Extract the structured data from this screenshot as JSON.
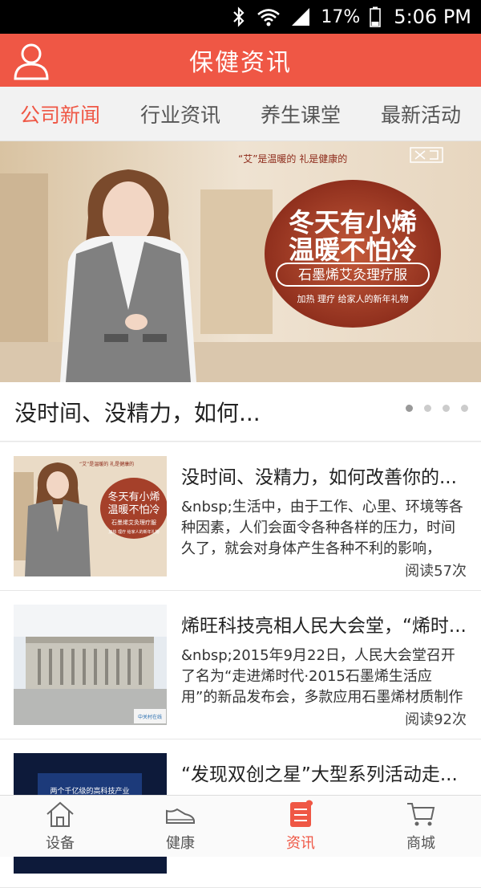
{
  "status_bar": {
    "battery": "17%",
    "time": "5:06 PM",
    "icons": [
      "bluetooth-icon",
      "wifi-icon",
      "signal-icon",
      "battery-icon"
    ]
  },
  "app_bar": {
    "title": "保健资讯",
    "left_icon": "user-icon"
  },
  "tabs": [
    {
      "label": "公司新闻",
      "active": true
    },
    {
      "label": "行业资讯",
      "active": false
    },
    {
      "label": "养生课堂",
      "active": false
    },
    {
      "label": "最新活动",
      "active": false
    }
  ],
  "banner": {
    "tagline": "“艾”是温暖的 礼是健康的",
    "headline_1": "冬天有小烯",
    "headline_2": "温暖不怕冷",
    "product": "石墨烯艾灸理疗服",
    "subline": "加热 理疗 给家人的新年礼物",
    "caption": "没时间、没精力，如何...",
    "page_count": 4,
    "active_page": 0
  },
  "articles": [
    {
      "title": "没时间、没精力，如何改善你的...",
      "desc": "&nbsp;生活中，由于工作、心里、环境等各种因素，人们会面令各种各样的压力，时间久了，就会对身体产生各种不利的影响，",
      "reads": "阅读57次",
      "thumb": "vest-ad-image",
      "thumb_text": {
        "tagline": "“艾”是温暖的 礼是健康的",
        "line1": "冬天有小烯",
        "line2": "温暖不怕冷",
        "product": "石墨烯艾灸理疗服",
        "subline": "加热 理疗 给家人的新年礼物"
      }
    },
    {
      "title": "烯旺科技亮相人民大会堂，“烯时...",
      "desc": "&nbsp;2015年9月22日，人民大会堂召开了名为“走进烯时代·2015石墨烯生活应用”的新品发布会，多款应用石墨烯材质制作的民...",
      "reads": "阅读92次",
      "thumb": "great-hall-image",
      "watermark": "中关村在线"
    },
    {
      "title": "“发现双创之星”大型系列活动走...",
      "desc": "",
      "reads": "",
      "thumb": "stage-event-image",
      "thumb_text": "两个千亿级的高科技产业"
    }
  ],
  "bottom_nav": [
    {
      "label": "设备",
      "icon": "home-icon",
      "active": false
    },
    {
      "label": "健康",
      "icon": "shoe-icon",
      "active": false
    },
    {
      "label": "资讯",
      "icon": "news-icon",
      "active": true
    },
    {
      "label": "商城",
      "icon": "cart-icon",
      "active": false
    }
  ],
  "colors": {
    "accent": "#ef5745",
    "banner_badge": "#b24a30"
  }
}
